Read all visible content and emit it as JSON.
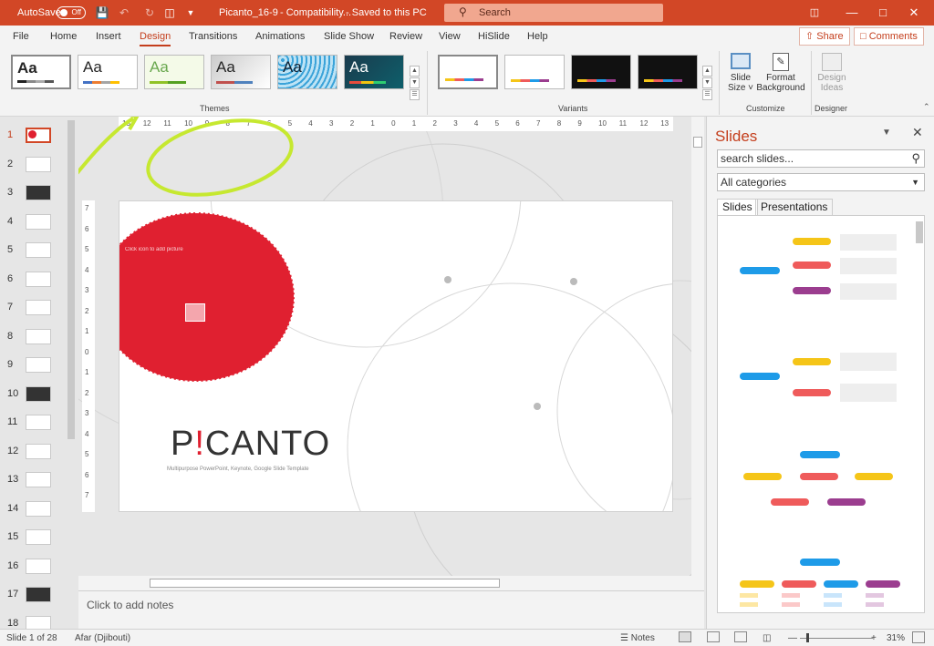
{
  "titlebar": {
    "autosave_label": "AutoSave",
    "autosave_state": "Off",
    "filename": "Picanto_16-9",
    "mode": "Compatibility...",
    "save_state": "Saved to this PC",
    "search_placeholder": "Search",
    "bg_color": "#d24726"
  },
  "tabs": [
    "File",
    "Home",
    "Insert",
    "Design",
    "Transitions",
    "Animations",
    "Slide Show",
    "Review",
    "View",
    "HiSlide",
    "Help"
  ],
  "active_tab": "Design",
  "header_buttons": {
    "share": "Share",
    "comments": "Comments"
  },
  "ribbon": {
    "theme_sample": "Aa",
    "groups": {
      "themes": "Themes",
      "variants": "Variants",
      "customize": "Customize",
      "designer": "Designer"
    },
    "slide_size": "Slide\nSize",
    "slide_size_line1": "Slide",
    "slide_size_line2": "Size",
    "format_bg_line1": "Format",
    "format_bg_line2": "Background",
    "design_ideas_line1": "Design",
    "design_ideas_line2": "Ideas"
  },
  "ruler_ticks": [
    "13",
    "12",
    "11",
    "10",
    "9",
    "8",
    "7",
    "6",
    "5",
    "4",
    "3",
    "2",
    "1",
    "0",
    "1",
    "2",
    "3",
    "4",
    "5",
    "6",
    "7",
    "8",
    "9",
    "10",
    "11",
    "12",
    "13"
  ],
  "vruler_ticks": [
    "7",
    "6",
    "5",
    "4",
    "3",
    "2",
    "1",
    "0",
    "1",
    "2",
    "3",
    "4",
    "5",
    "6",
    "7"
  ],
  "slide_numbers": [
    "1",
    "2",
    "3",
    "4",
    "5",
    "6",
    "7",
    "8",
    "9",
    "10",
    "11",
    "12",
    "13",
    "14",
    "15",
    "16",
    "17",
    "18"
  ],
  "slide": {
    "placeholder": "Click icon to add picture",
    "brand_p": "P",
    "brand_bang": "!",
    "brand_rest": "CANTO",
    "subtitle": "Multipurpose PowerPoint, Keynote, Google Slide Template",
    "accent": "#e02030"
  },
  "notes_placeholder": "Click to add notes",
  "rpane": {
    "title": "Slides",
    "search_placeholder": "search slides...",
    "category": "All categories",
    "tabs": [
      "Slides",
      "Presentations"
    ]
  },
  "status": {
    "slide_of": "Slide 1 of 28",
    "language": "Afar (Djibouti)",
    "notes": "Notes",
    "zoom": "31%"
  },
  "colors": {
    "accent": "#c43e1c",
    "pill_yellow": "#f5c518",
    "pill_red": "#ef5b5b",
    "pill_purple": "#9b3d8f",
    "pill_blue": "#1e9be8"
  }
}
